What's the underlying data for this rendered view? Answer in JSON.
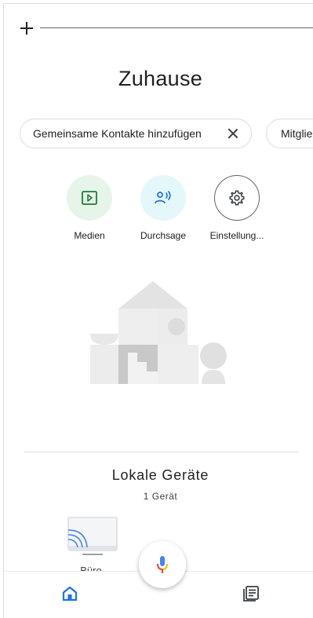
{
  "header": {
    "add_icon": "plus-icon"
  },
  "home": {
    "title": "Zuhause"
  },
  "chips": [
    {
      "label": "Gemeinsame Kontakte hinzufügen",
      "dismiss_icon": "close-icon"
    },
    {
      "label": "Mitglie"
    }
  ],
  "actions": [
    {
      "label": "Medien",
      "icon": "media-play-icon",
      "color": "#e6f4ea"
    },
    {
      "label": "Durchsage",
      "icon": "broadcast-person-icon",
      "color": "#e4f7fb"
    },
    {
      "label": "Einstellung...",
      "icon": "gear-icon"
    }
  ],
  "local_devices": {
    "title": "Lokale Geräte",
    "count": "1 Gerät",
    "devices": [
      {
        "label": "Büro",
        "icon": "cast-display-icon"
      }
    ]
  },
  "bottom_nav": {
    "home_icon": "home-icon",
    "feed_icon": "feed-icon",
    "mic_icon": "microphone-icon"
  },
  "colors": {
    "home_blue": "#1a73e8",
    "green": "#188038",
    "mic_blue": "#4285f4",
    "mic_red": "#ea4335",
    "mic_yellow": "#fbbc04"
  }
}
